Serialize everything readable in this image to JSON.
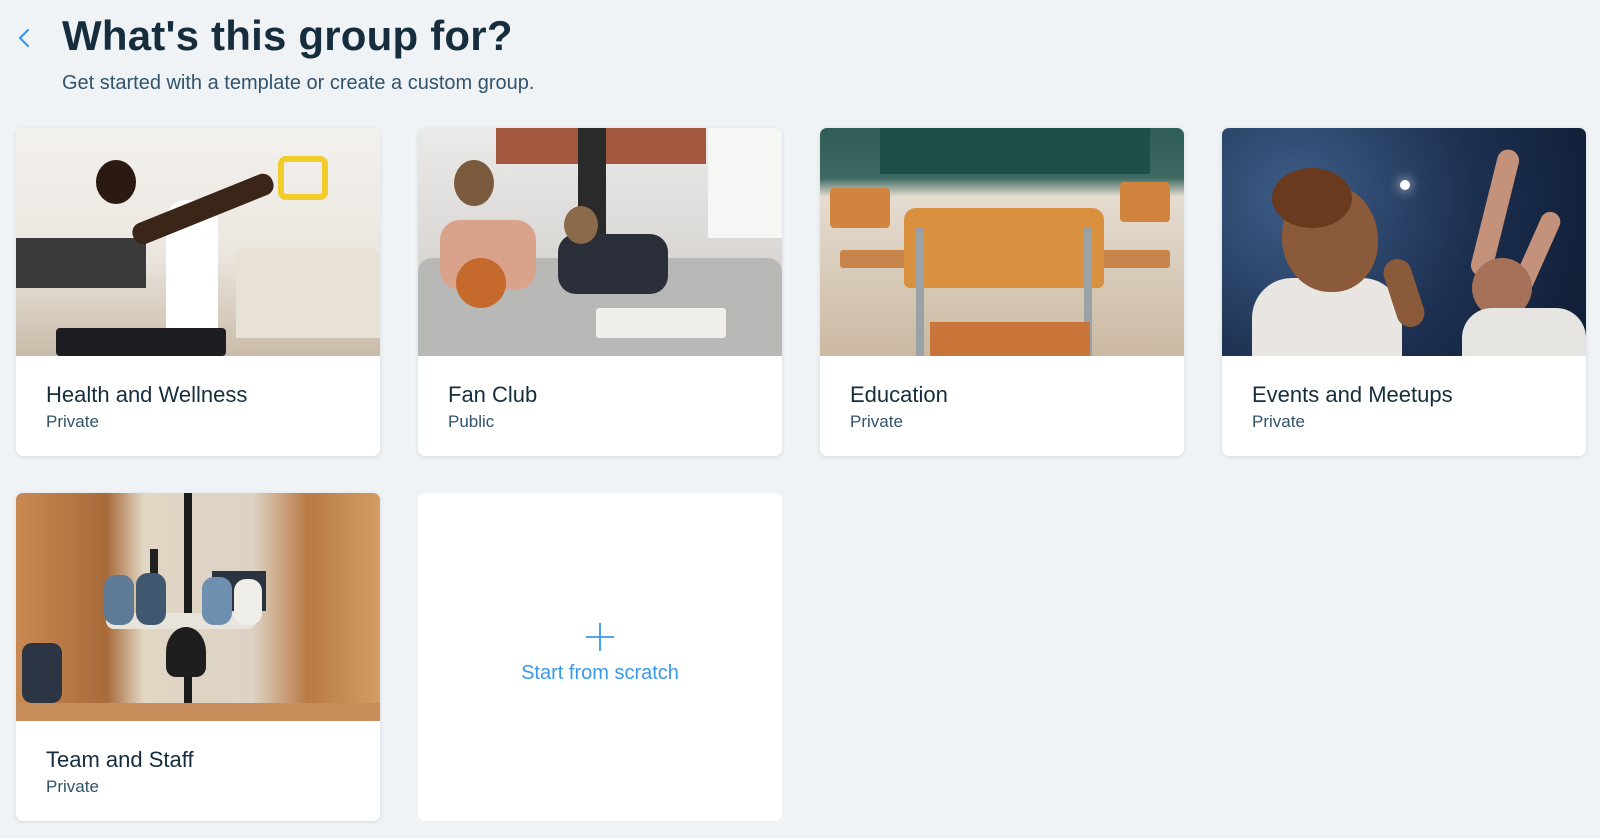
{
  "header": {
    "title": "What's this group for?",
    "subtitle": "Get started with a template or create a custom group."
  },
  "templates": [
    {
      "title": "Health and Wellness",
      "privacy": "Private",
      "image": "person-exercising-resistance-band-living-room"
    },
    {
      "title": "Fan Club",
      "privacy": "Public",
      "image": "friends-on-sofa-with-basketball"
    },
    {
      "title": "Education",
      "privacy": "Private",
      "image": "empty-classroom-chairs"
    },
    {
      "title": "Events and Meetups",
      "privacy": "Private",
      "image": "cheering-crowd-at-concert"
    },
    {
      "title": "Team and Staff",
      "privacy": "Private",
      "image": "team-meeting-in-glass-room"
    }
  ],
  "scratch": {
    "label": "Start from scratch"
  },
  "icons": {
    "back": "chevron-left-icon",
    "add": "plus-icon"
  },
  "colors": {
    "accent": "#3899ec",
    "text": "#162d3d",
    "secondary_text": "#32536a",
    "background": "#eff3f6"
  }
}
